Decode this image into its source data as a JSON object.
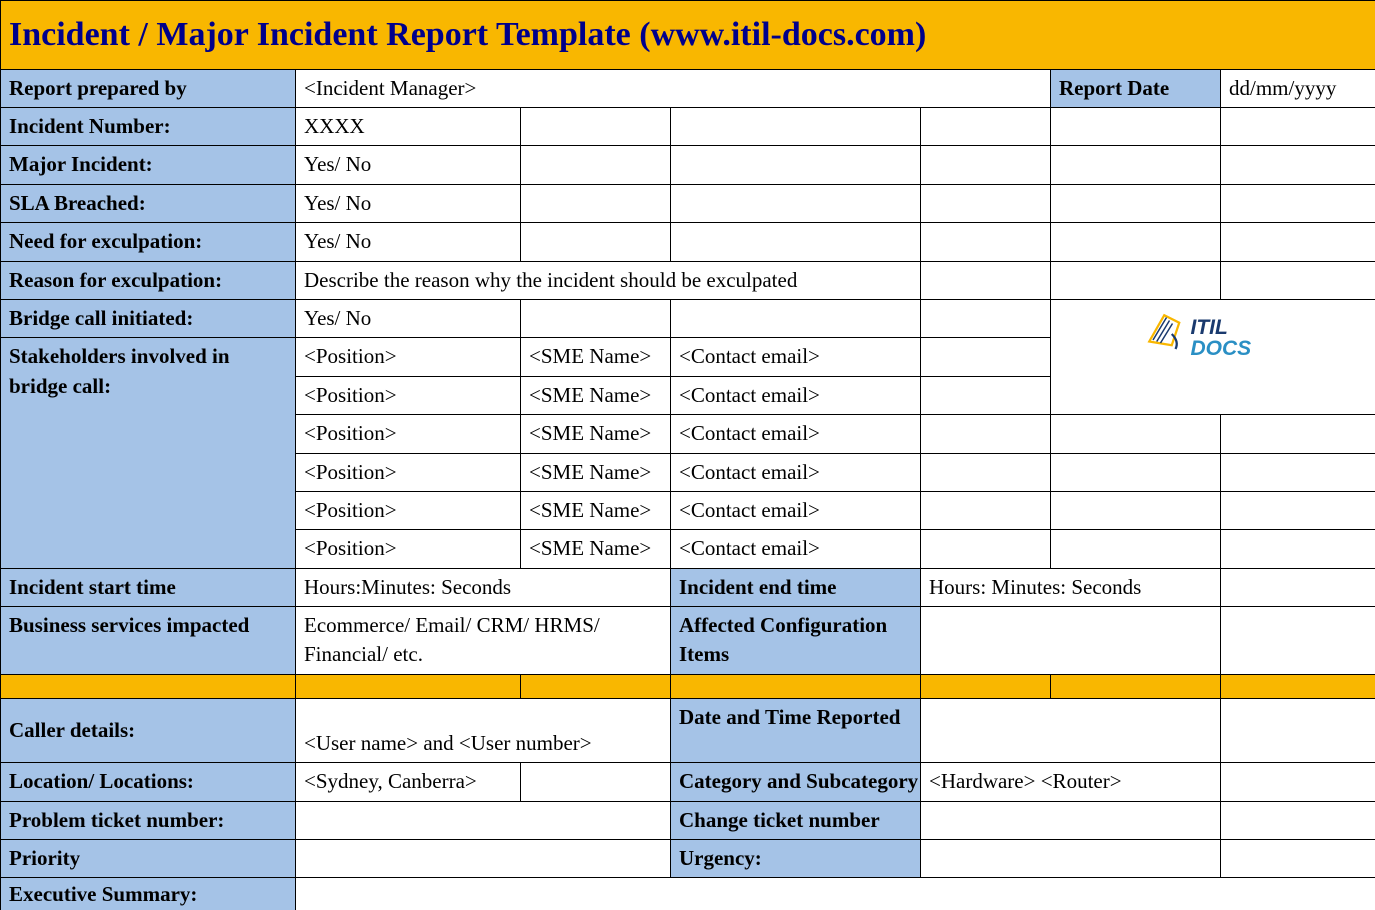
{
  "title": "Incident / Major Incident Report Template   (www.itil-docs.com)",
  "labels": {
    "reportPreparedBy": "Report prepared by",
    "reportDate": "Report Date",
    "incidentNumber": "Incident Number:",
    "majorIncident": "Major Incident:",
    "slaBreached": "SLA Breached:",
    "needExculpation": "Need for exculpation:",
    "reasonExculpation": "Reason for exculpation:",
    "bridgeCall": "Bridge call initiated:",
    "stakeholders": "Stakeholders involved in bridge call:",
    "incidentStart": "Incident start time",
    "incidentEnd": "Incident end time",
    "businessServices": "Business services impacted",
    "affectedCI": "Affected Configuration Items",
    "callerDetails": "Caller details:",
    "dateTimeReported": "Date and Time Reported",
    "location": "Location/ Locations:",
    "categorySubcategory": "Category and Subcategory",
    "problemTicket": "Problem ticket number:",
    "changeTicket": "Change ticket number",
    "priority": "Priority",
    "urgency": "Urgency:",
    "executiveSummary": "Executive Summary:"
  },
  "values": {
    "reportPreparedBy": "<Incident Manager>",
    "reportDate": "dd/mm/yyyy",
    "incidentNumber": "XXXX",
    "majorIncident": "Yes/ No",
    "slaBreached": "Yes/ No",
    "needExculpation": "Yes/ No",
    "reasonExculpation": "Describe the reason why the incident should be exculpated",
    "bridgeCall": "Yes/ No",
    "incidentStart": "Hours:Minutes: Seconds",
    "incidentEnd": "Hours: Minutes: Seconds",
    "businessServices": "Ecommerce/ Email/ CRM/ HRMS/ Financial/ etc.",
    "callerDetails": "<User name> and <User number>",
    "location": "<Sydney, Canberra>",
    "categorySubcategory": "<Hardware> <Router>"
  },
  "stakeholders": [
    {
      "position": "<Position>",
      "sme": "<SME Name>",
      "email": "<Contact email>"
    },
    {
      "position": "<Position>",
      "sme": "<SME Name>",
      "email": "<Contact email>"
    },
    {
      "position": "<Position>",
      "sme": "<SME Name>",
      "email": "<Contact email>"
    },
    {
      "position": "<Position>",
      "sme": "<SME Name>",
      "email": "<Contact email>"
    },
    {
      "position": "<Position>",
      "sme": "<SME Name>",
      "email": "<Contact email>"
    },
    {
      "position": "<Position>",
      "sme": "<SME Name>",
      "email": "<Contact email>"
    }
  ],
  "logo": {
    "text1": "ITIL",
    "text2": "DOCS"
  }
}
